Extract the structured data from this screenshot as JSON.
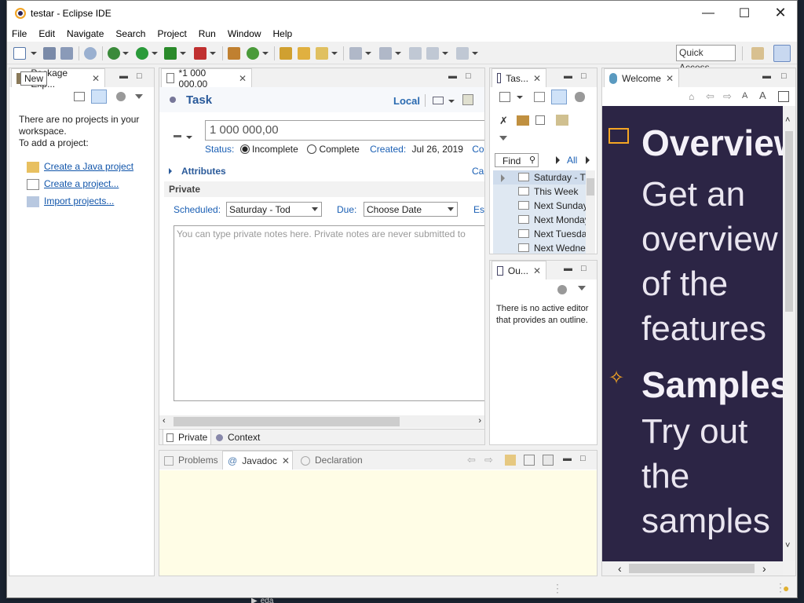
{
  "window": {
    "title": "testar - Eclipse IDE"
  },
  "menu": [
    "File",
    "Edit",
    "Navigate",
    "Search",
    "Project",
    "Run",
    "Window",
    "Help"
  ],
  "toolbar": {
    "quick_access": "Quick Access"
  },
  "tooltip": "New",
  "package_explorer": {
    "tab": "Package Exp...",
    "msg1": "There are no projects in your workspace.",
    "msg2": "To add a project:",
    "links": [
      "Create a Java project",
      "Create a project...",
      "Import projects..."
    ]
  },
  "task_editor": {
    "tab": "*1 000 000,00",
    "header": "Task",
    "local": "Local",
    "summary": "1 000 000,00",
    "status_label": "Status:",
    "incomplete": "Incomplete",
    "complete": "Complete",
    "created_label": "Created:",
    "created_value": "Jul 26, 2019",
    "con": "Con",
    "attributes": "Attributes",
    "cat": "Ca",
    "private": "Private",
    "scheduled_label": "Scheduled:",
    "scheduled_value": "Saturday - Tod",
    "due_label": "Due:",
    "due_value": "Choose Date",
    "est": "Est",
    "notes_placeholder": "You can type private notes here. Private notes are never submitted to",
    "bottom_tabs": [
      "Private",
      "Context"
    ]
  },
  "task_list": {
    "tab": "Tas...",
    "find": "Find",
    "all": "All",
    "items": [
      "Saturday - T",
      "This Week",
      "Next Sunday",
      "Next Monday",
      "Next Tuesday",
      "Next Wedne"
    ]
  },
  "outline": {
    "tab": "Ou...",
    "msg": "There is no active editor that provides an outline."
  },
  "welcome": {
    "tab": "Welcome",
    "overview_title": "Overview",
    "overview_text": [
      "Get an",
      "overview",
      "of the",
      "features"
    ],
    "samples_title": "Samples",
    "samples_text": [
      "Try out",
      "the",
      "samples"
    ]
  },
  "bottom": {
    "tabs": [
      "Problems",
      "Javadoc",
      "Declaration"
    ]
  },
  "taskbar": {
    "item": "eda"
  },
  "colors": {
    "welcome_bg": "#2c2545",
    "accent": "#f5a623",
    "javadoc_bg": "#fffde6"
  }
}
